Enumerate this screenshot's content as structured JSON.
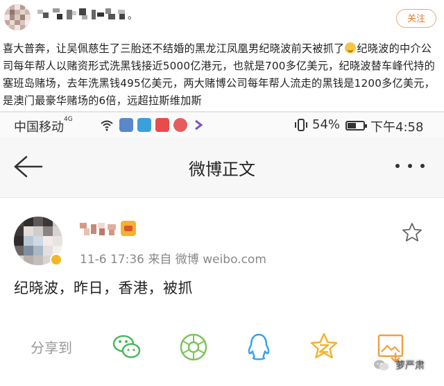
{
  "top": {
    "name_suffix": "。",
    "follow_label": "关注",
    "text": "喜大普奔，让吴佩慈生了三胎还不结婚的黑龙江凤凰男纪晓波前天被抓了",
    "text2": "纪晓波的中介公司每年帮人以赌资形式洗黑钱接近5000亿港元，也就是700多亿美元，纪晓波替车峰代持的塞班岛赌场，去年洗黑钱495亿美元，两大赌博公司每年帮人流走的黑钱是1200多亿美元，是澳门最豪华赌场的6倍，远超拉斯维加斯"
  },
  "status_bar": {
    "carrier": "中国移动",
    "network": "4G",
    "battery": "54%",
    "battery_level": 0.54,
    "time": "下午4:58"
  },
  "navbar": {
    "title": "微博正文"
  },
  "post": {
    "meta": "11-6 17:36   来自 微博 weibo.com",
    "body": "纪晓波，昨日，香港，被抓"
  },
  "share": {
    "label": "分享到",
    "targets": [
      "wechat-icon",
      "moments-icon",
      "qq-icon",
      "qzone-icon",
      "save-image-icon"
    ]
  },
  "watermark": {
    "text": "萝严肃"
  },
  "colors": {
    "accent": "#e8772e",
    "share_green": "#4cb85c",
    "share_blue": "#3aa0e8",
    "share_yellow": "#f3b330"
  }
}
